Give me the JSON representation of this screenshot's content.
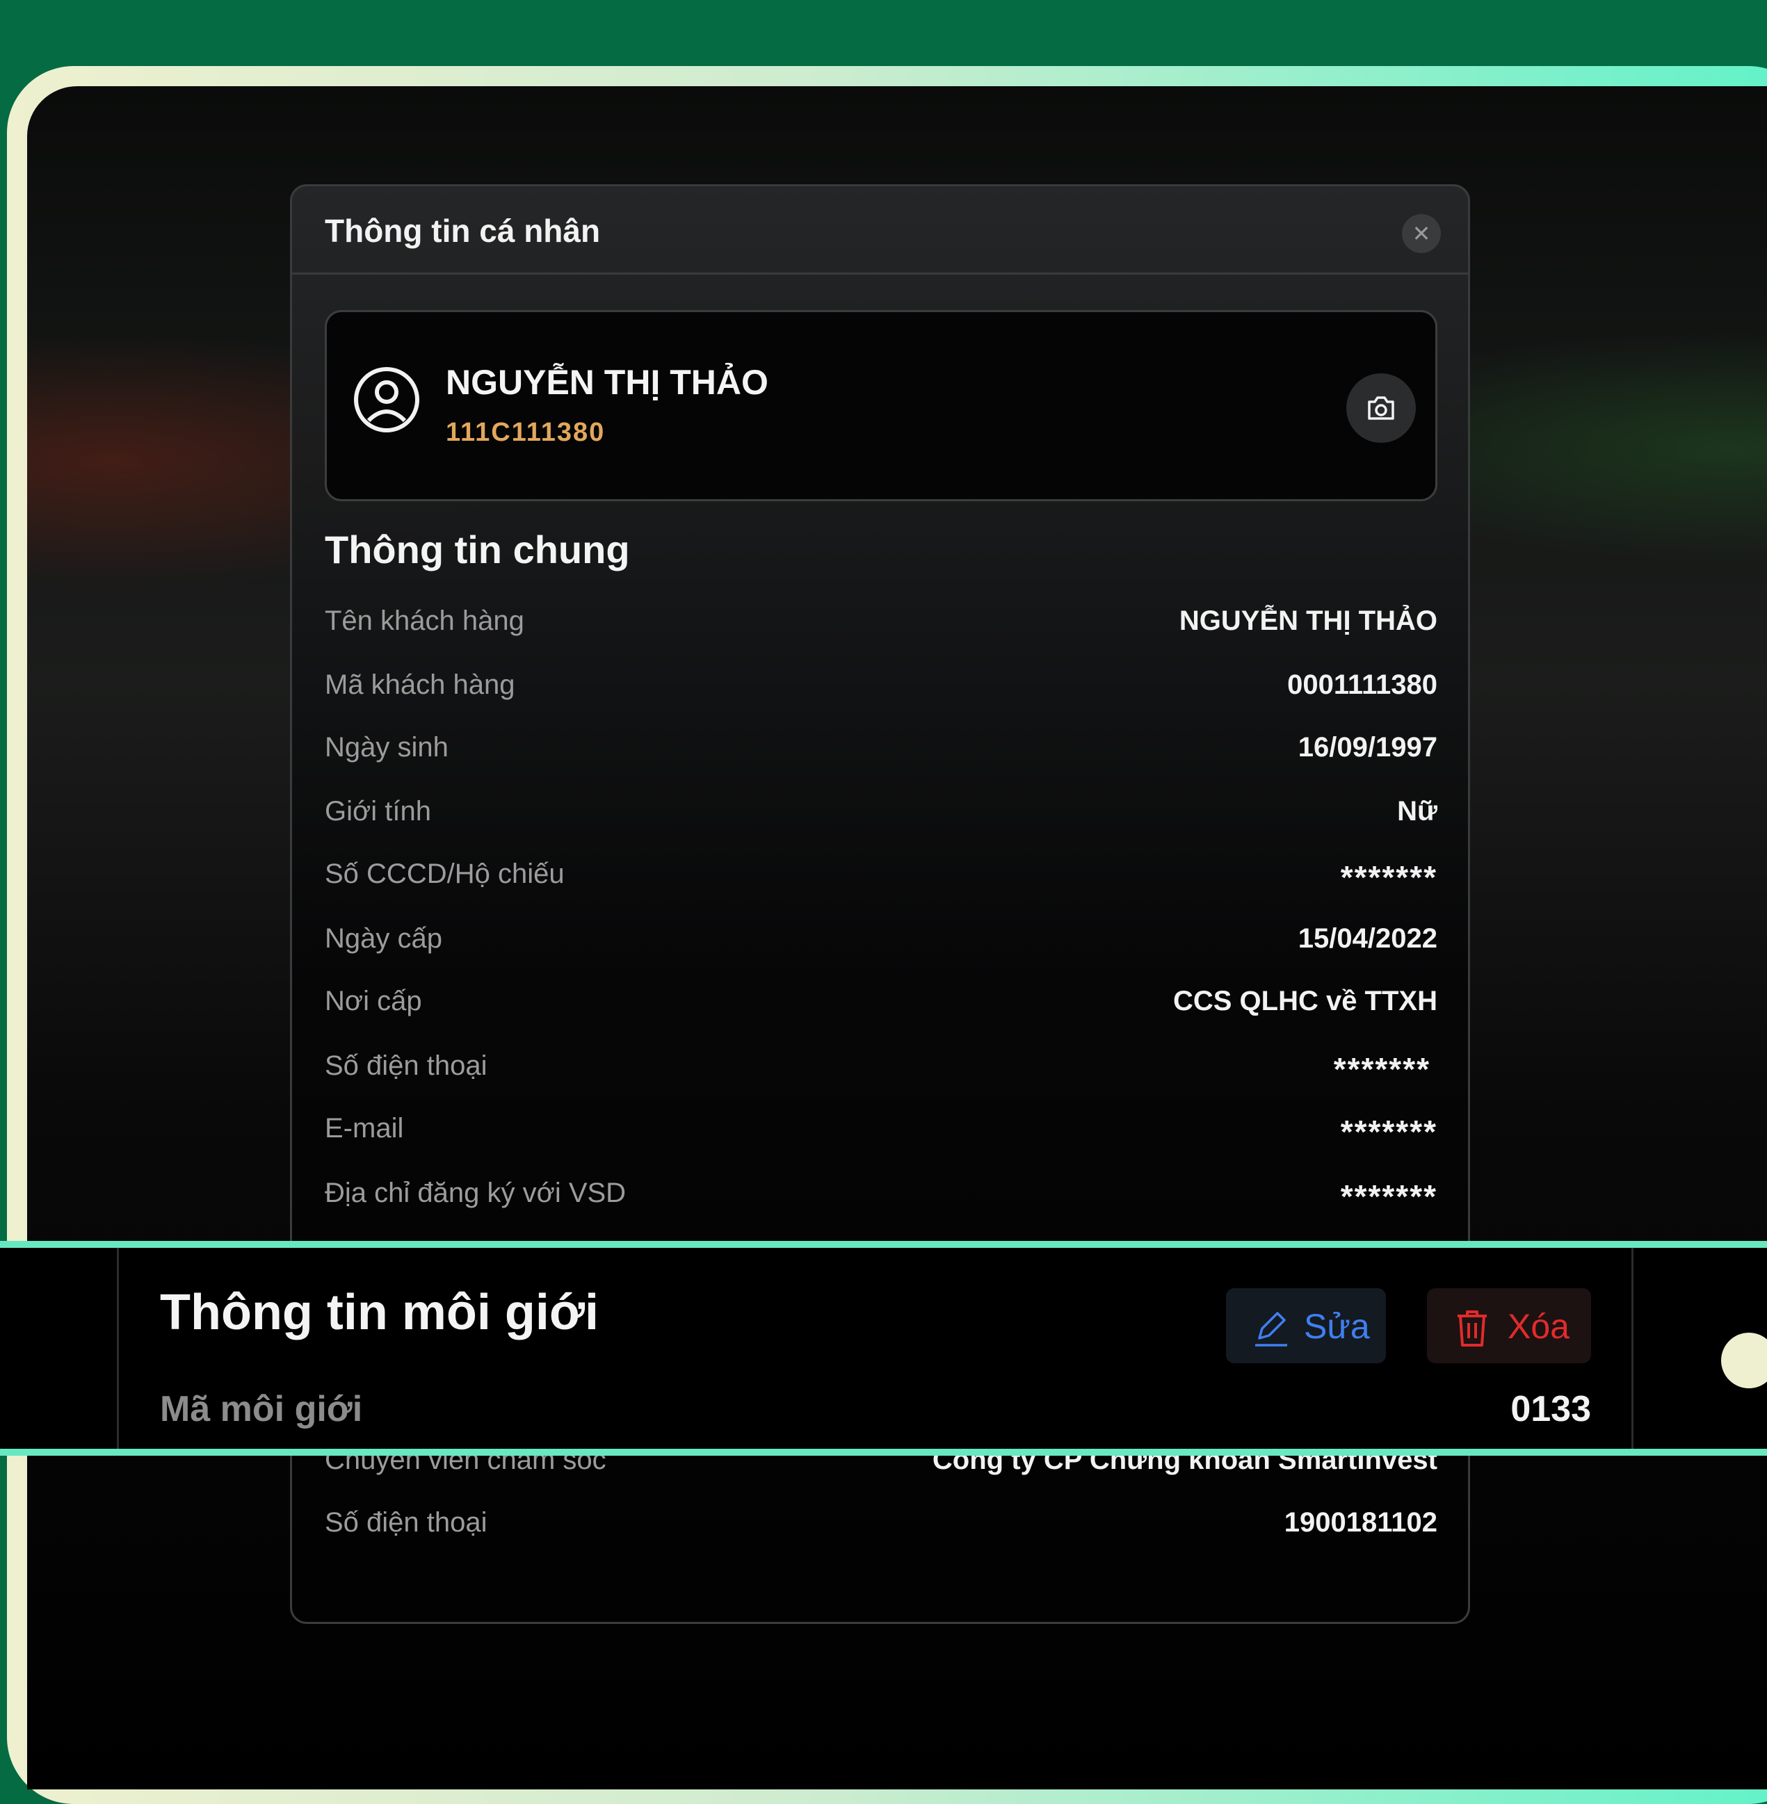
{
  "modal": {
    "title": "Thông tin cá nhân",
    "close_icon": "close-icon"
  },
  "profile": {
    "name": "NGUYỄN THỊ THẢO",
    "id": "111C111380",
    "avatar_icon": "user-circle-icon",
    "camera_icon": "camera-icon"
  },
  "general": {
    "title": "Thông tin chung",
    "rows": [
      {
        "label": "Tên khách hàng",
        "value": "NGUYỄN THỊ THẢO"
      },
      {
        "label": "Mã khách hàng",
        "value": "0001111380"
      },
      {
        "label": "Ngày sinh",
        "value": "16/09/1997"
      },
      {
        "label": "Giới tính",
        "value": "Nữ"
      },
      {
        "label": "Số CCCD/Hộ chiếu",
        "value": "*******"
      },
      {
        "label": "Ngày cấp",
        "value": "15/04/2022"
      },
      {
        "label": "Nơi cấp",
        "value": "CCS QLHC về TTXH"
      },
      {
        "label": "Số điện thoại",
        "value": "*******"
      },
      {
        "label": "E-mail",
        "value": "*******"
      },
      {
        "label": "Địa chỉ đăng ký với VSD",
        "value": "*******"
      }
    ]
  },
  "broker": {
    "title": "Thông tin môi giới",
    "edit_label": "Sửa",
    "delete_label": "Xóa",
    "code_label": "Mã môi giới",
    "code_value": "0133"
  },
  "care": {
    "rows": [
      {
        "label": "Chuyên viên chăm sóc",
        "value": "Công ty CP Chứng khoán SmartInvest"
      },
      {
        "label": "Số điện thoại",
        "value": "1900181102"
      }
    ]
  },
  "colors": {
    "background": "#046b43",
    "accent_teal": "#68e8c0",
    "id_gold": "#e2a75c",
    "edit_blue": "#3f7ff0",
    "delete_red": "#e12b2b"
  }
}
